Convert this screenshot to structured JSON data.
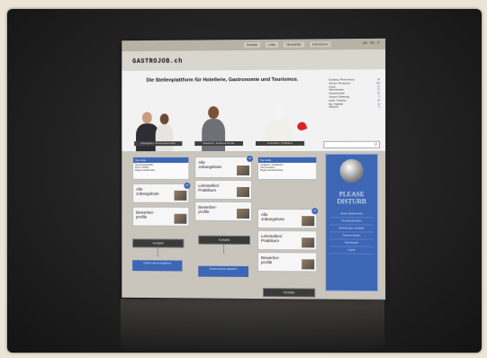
{
  "site": {
    "logo": "GASTROJOB.ch",
    "tagline": "Die Stellenplattform für Hotellerie, Gastronomie und Tourismus.",
    "top_nav": [
      "Kontakt",
      "Links",
      "Newsletter",
      "Impressum"
    ],
    "languages": [
      "DE",
      "FR",
      "IT"
    ],
    "hero_labels": [
      "Arbeitgeber / Personalvermittler",
      "Bewerber / Stellensuchende",
      "Lehrstellen / Praktikum"
    ],
    "search_placeholder": "Job suchen",
    "job_categories": [
      {
        "name": "Empfang / Reservierung",
        "count": "33"
      },
      {
        "name": "Service / Restaurant",
        "count": "126"
      },
      {
        "name": "Küche",
        "count": "87"
      },
      {
        "name": "Administration",
        "count": "14"
      },
      {
        "name": "Hauswirtschaft",
        "count": "22"
      },
      {
        "name": "Verkauf / Marketing",
        "count": "9"
      },
      {
        "name": "Kader / Direktion",
        "count": "18"
      },
      {
        "name": "Bar / Nightlife",
        "count": "11"
      },
      {
        "name": "Wellness",
        "count": "5"
      }
    ]
  },
  "columns": {
    "left": {
      "box_title": "Top Jobs",
      "box_text": [
        "Serviceangestellte",
        "Koch / Köchin",
        "Region Graubünden"
      ],
      "tiles": [
        {
          "label": "Alle Jobangebote",
          "badge": "53"
        },
        {
          "label": "Bewerber-profile",
          "badge": ""
        }
      ],
      "dark_button": "Kontakte",
      "blue_button": "Gratis Inserat aufgeben"
    },
    "middle": {
      "tiles": [
        {
          "label": "Alle Jobangebote",
          "badge": "43"
        },
        {
          "label": "Lehrstellen/ Praktikum",
          "badge": ""
        },
        {
          "label": "Bewerber-profile",
          "badge": ""
        }
      ],
      "dark_button": "Kontakte",
      "blue_button": "Gratis Inserat aufgeben"
    },
    "right": {
      "box_title": "Top Jobs",
      "box_text": [
        "Jungkoch / Jungköchin",
        "Chef de Partie",
        "Region Zentralschweiz"
      ],
      "tiles": [
        {
          "label": "Alle Jobangebote",
          "badge": "46"
        },
        {
          "label": "Lehrstellen/ Praktikum",
          "badge": ""
        },
        {
          "label": "Bewerber-profile",
          "badge": ""
        }
      ],
      "dark_button": "Kontakte"
    }
  },
  "side_panel": {
    "title": "PLEASE DISTURB",
    "links": [
      "Neues Stelleninserat",
      "Firmenprofil ändern",
      "Bewerbungen verwalten",
      "Passwort ändern",
      "Rechnungen",
      "Logout"
    ]
  },
  "colors": {
    "frame": "#2b2b2b",
    "accent_blue": "#3d66b5",
    "background": "#ece4d6"
  }
}
